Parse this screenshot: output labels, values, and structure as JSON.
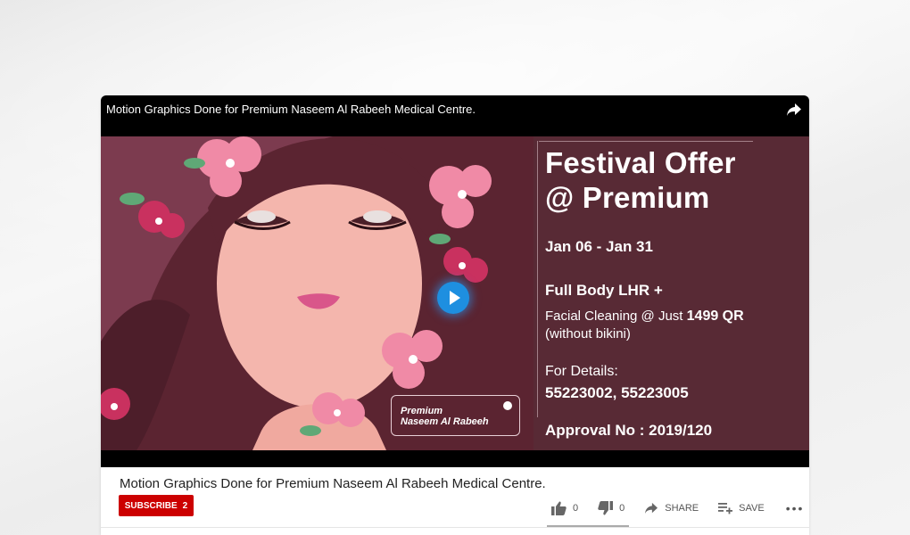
{
  "video": {
    "title": "Motion Graphics Done for Premium Naseem Al Rabeeh Medical Centre.",
    "thumbnail": {
      "headline_line1": "Festival Offer",
      "headline_line2": "@ Premium",
      "dates": "Jan 06 - Jan 31",
      "service": "Full Body LHR +",
      "facial_prefix": "Facial Cleaning @ Just ",
      "facial_price": "1499 QR",
      "facial_note": "(without bikini)",
      "details_label": "For Details:",
      "details_phones": "55223002, 55223005",
      "approval": "Approval No : 2019/120",
      "logo_line1": "Premium",
      "logo_line2": "Naseem Al Rabeeh"
    }
  },
  "channel": {
    "subscribe_label": "SUBSCRIBE",
    "subscriber_count": "2"
  },
  "actions": {
    "likes": "0",
    "dislikes": "0",
    "share_label": "SHARE",
    "save_label": "SAVE",
    "more_label": "•••"
  },
  "icons": [
    "share-arrow-icon",
    "play-icon",
    "thumbs-up-icon",
    "thumbs-down-icon",
    "share-icon",
    "playlist-add-icon",
    "more-icon"
  ],
  "colors": {
    "subscribe": "#cc0000",
    "thumbnail_bg": "#582a35",
    "play_button": "#1e8fe0"
  }
}
